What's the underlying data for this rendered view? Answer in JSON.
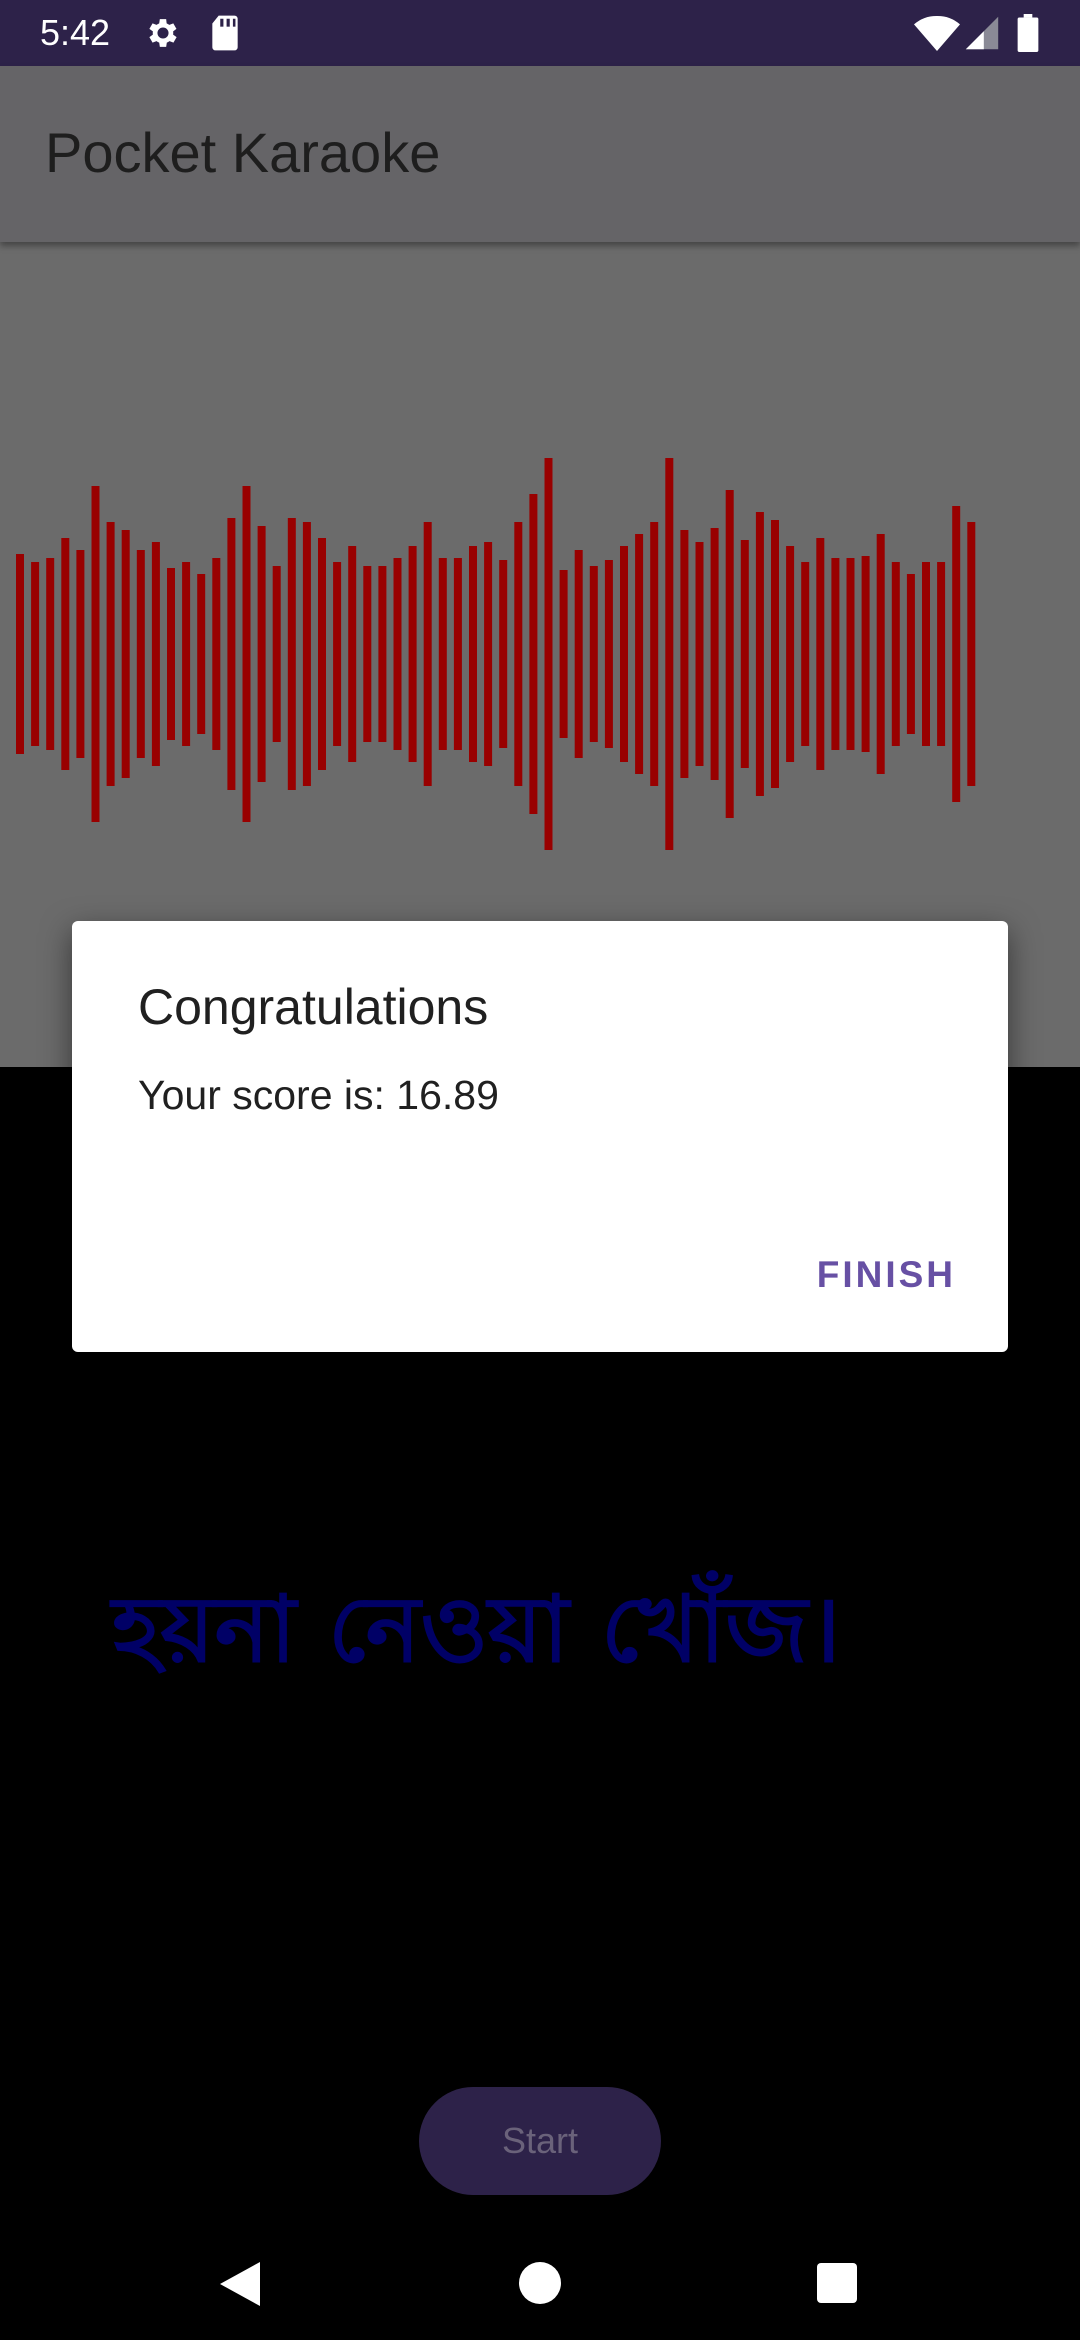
{
  "status_bar": {
    "time": "5:42",
    "icons": [
      "gear-icon",
      "sd-card-icon",
      "wifi-icon",
      "cellular-signal-icon",
      "battery-icon"
    ],
    "background": "#2d2249"
  },
  "app_bar": {
    "title": "Pocket Karaoke"
  },
  "visualizer": {
    "bar_color": "#990000",
    "background": "#6b6b6b",
    "bar_levels": [
      0.5,
      0.46,
      0.48,
      0.58,
      0.52,
      0.84,
      0.66,
      0.62,
      0.52,
      0.56,
      0.43,
      0.46,
      0.4,
      0.48,
      0.68,
      0.84,
      0.64,
      0.44,
      0.68,
      0.66,
      0.58,
      0.46,
      0.54,
      0.44,
      0.44,
      0.48,
      0.54,
      0.66,
      0.48,
      0.48,
      0.54,
      0.56,
      0.47,
      0.66,
      0.8,
      0.98,
      0.42,
      0.52,
      0.44,
      0.47,
      0.54,
      0.6,
      0.66,
      0.98,
      0.62,
      0.56,
      0.63,
      0.82,
      0.57,
      0.71,
      0.67,
      0.54,
      0.46,
      0.58,
      0.48,
      0.48,
      0.49,
      0.6,
      0.46,
      0.4,
      0.46,
      0.46,
      0.74,
      0.66
    ]
  },
  "dialog": {
    "title": "Congratulations",
    "message": "Your score is: 16.89",
    "button_label": "FINISH",
    "accent": "#6750a4"
  },
  "lyrics": {
    "text": "হয়না নেওয়া খোঁজ।",
    "color": "#000066"
  },
  "start_button": {
    "label": "Start"
  },
  "nav_bar": {
    "icons": [
      "back-icon",
      "home-icon",
      "recents-icon"
    ]
  }
}
